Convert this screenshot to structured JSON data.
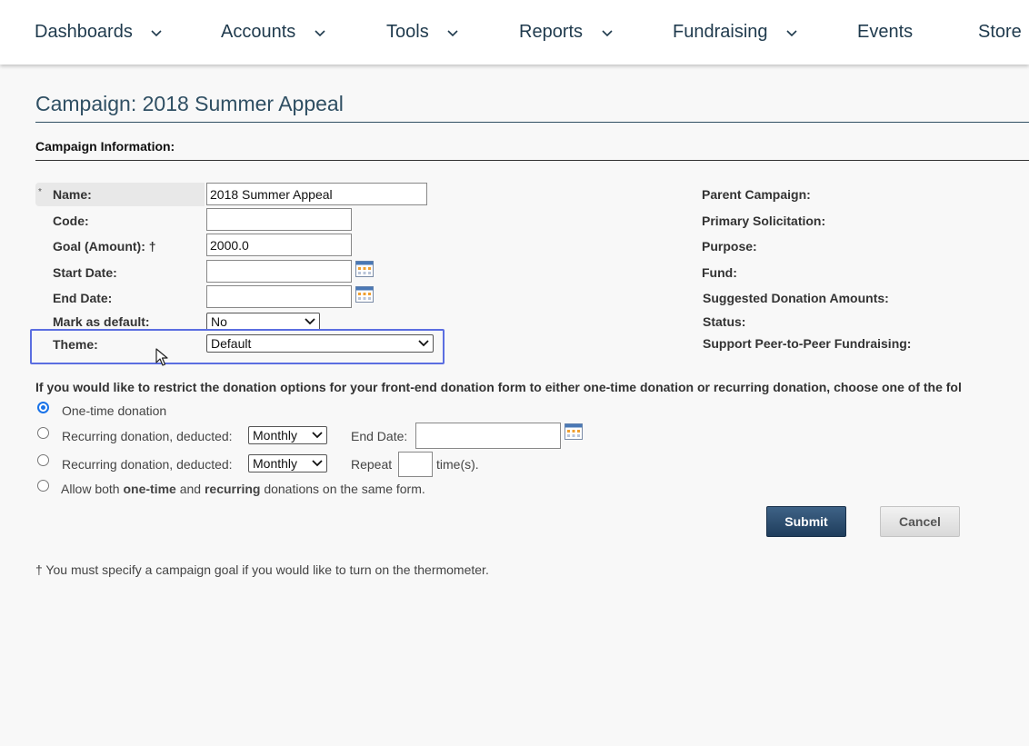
{
  "nav": {
    "items": [
      {
        "label": "Dashboards",
        "dropdown": true
      },
      {
        "label": "Accounts",
        "dropdown": true
      },
      {
        "label": "Tools",
        "dropdown": true
      },
      {
        "label": "Reports",
        "dropdown": true
      },
      {
        "label": "Fundraising",
        "dropdown": true
      },
      {
        "label": "Events",
        "dropdown": false
      },
      {
        "label": "Store",
        "dropdown": false
      }
    ]
  },
  "page": {
    "title": "Campaign: 2018 Summer Appeal",
    "section_heading": "Campaign Information:"
  },
  "form": {
    "required_mark": "*",
    "name_label": "Name:",
    "name_value": "2018 Summer Appeal",
    "code_label": "Code:",
    "code_value": "",
    "goal_label": "Goal (Amount): †",
    "goal_value": "2000.0",
    "start_date_label": "Start Date:",
    "start_date_value": "",
    "end_date_label": "End Date:",
    "end_date_value": "",
    "default_label": "Mark as default:",
    "default_value": "No",
    "theme_label": "Theme:",
    "theme_value": "Default"
  },
  "right_labels": {
    "parent_campaign": "Parent Campaign:",
    "primary_solicitation": "Primary Solicitation:",
    "purpose": "Purpose:",
    "fund": "Fund:",
    "suggested_amounts": "Suggested Donation Amounts:",
    "status": "Status:",
    "peer_to_peer": "Support Peer-to-Peer Fundraising:"
  },
  "donation_options": {
    "instructions": "If you would like to restrict the donation options for your front-end donation form to either one-time donation or recurring donation, choose one of the fol",
    "one_time_label": "One-time donation",
    "recurring_label": "Recurring donation, deducted:",
    "frequency_value_1": "Monthly",
    "end_date_label": "End Date:",
    "end_date_value": "",
    "frequency_value_2": "Monthly",
    "repeat_label": "Repeat",
    "repeat_value": "",
    "times_label": "time(s).",
    "both_prefix": "Allow both",
    "both_one_time": "one-time",
    "both_and": "and",
    "both_recurring": "recurring",
    "both_suffix": "donations on the same form.",
    "selected": "one-time"
  },
  "buttons": {
    "submit": "Submit",
    "cancel": "Cancel"
  },
  "footnote": "† You must specify a campaign goal if you would like to turn on the thermometer.",
  "colors": {
    "nav_text": "#1f3a4d",
    "title": "#2f4f63",
    "highlight_border": "#5b6ee1",
    "submit_bg": "#2b4a6b",
    "radio_selected": "#1a73e8"
  }
}
